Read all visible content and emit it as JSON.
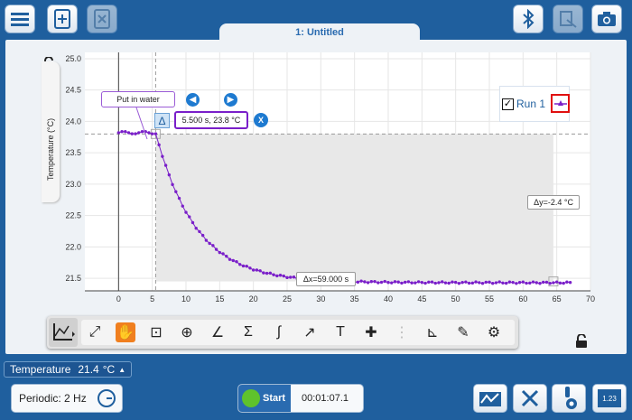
{
  "toolbar_top": {
    "menu_icon": "hamburger-menu-icon",
    "new_icon": "new-file-icon",
    "close_icon": "close-file-icon",
    "bluetooth_icon": "bluetooth-icon",
    "annotate_icon": "annotate-icon",
    "camera_icon": "camera-icon"
  },
  "tab": {
    "title": "1: Untitled"
  },
  "graph": {
    "ylabel": "Temperature (°C)",
    "annotation_label": "Put in water",
    "readout": "5.500 s, 23.8 °C",
    "delta_y": "Δy=-2.4 °C",
    "delta_x": "Δx=59.000 s",
    "legend_run": "Run 1",
    "legend_checked": true,
    "delta_symbol": "Δ",
    "close_x": "X"
  },
  "chart_data": {
    "type": "scatter",
    "xlim": [
      -5,
      70
    ],
    "ylim": [
      21.3,
      25.1
    ],
    "xticks": [
      "0",
      "5",
      "10",
      "15",
      "20",
      "25",
      "30",
      "35",
      "40",
      "45",
      "50",
      "55",
      "60",
      "65",
      "70"
    ],
    "yticks": [
      "21.5",
      "22.0",
      "22.5",
      "23.0",
      "23.5",
      "24.0",
      "24.5",
      "25.0"
    ],
    "ylabel": "Temperature (°C)",
    "grid": true,
    "series": [
      {
        "name": "Run 1",
        "color": "#7a1fc9",
        "x_start": 0,
        "x_end": 67,
        "dx": 0.5,
        "baseline": 23.82,
        "drop_at": 5.5,
        "final": 21.43,
        "tau": 6.0
      }
    ],
    "selection": {
      "x0": 5.5,
      "x1": 64.5,
      "y_top": 23.8,
      "y_bottom": 21.45
    }
  },
  "tools": [
    {
      "name": "fit-screen-icon",
      "glyph": "⤢"
    },
    {
      "name": "pan-zoom-icon",
      "glyph": "✋",
      "selected": true
    },
    {
      "name": "examine-icon",
      "glyph": "⊡"
    },
    {
      "name": "tangent-icon",
      "glyph": "⊕"
    },
    {
      "name": "slope-icon",
      "glyph": "∠"
    },
    {
      "name": "sigma-icon",
      "glyph": "Σ"
    },
    {
      "name": "integral-icon",
      "glyph": "∫"
    },
    {
      "name": "curve-fit-icon",
      "glyph": "↗"
    },
    {
      "name": "text-icon",
      "glyph": "T"
    },
    {
      "name": "add-point-icon",
      "glyph": "✚"
    },
    {
      "name": "model-icon",
      "glyph": "⋮"
    },
    {
      "name": "axis-icon",
      "glyph": "⊾"
    },
    {
      "name": "draw-icon",
      "glyph": "✎"
    },
    {
      "name": "settings-icon",
      "glyph": "⚙"
    }
  ],
  "bottom": {
    "sensor_label": "Temperature",
    "sensor_value": "21.4",
    "sensor_unit": "°C",
    "rate": "Periodic: 2 Hz",
    "start_label": "Start",
    "timer": "00:01:07.1",
    "meter_label": "1.23"
  }
}
